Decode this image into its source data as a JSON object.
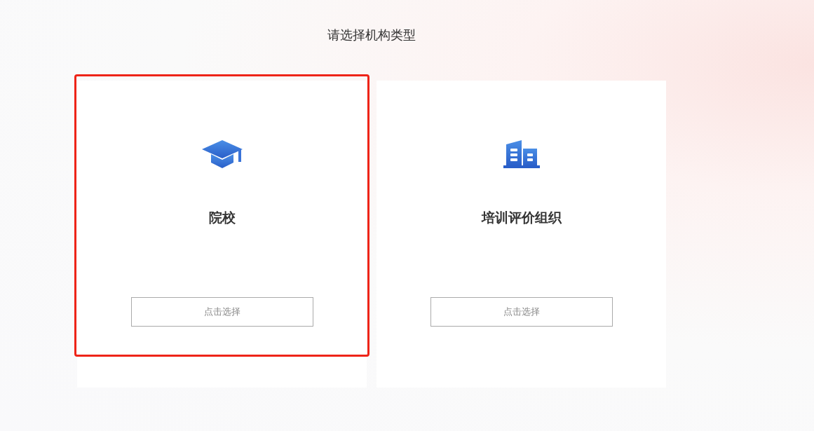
{
  "heading": "请选择机构类型",
  "cards": [
    {
      "kind": "cap",
      "title": "院校",
      "button": "点击选择",
      "highlighted": true
    },
    {
      "kind": "building",
      "title": "培训评价组织",
      "button": "点击选择",
      "highlighted": false
    }
  ]
}
